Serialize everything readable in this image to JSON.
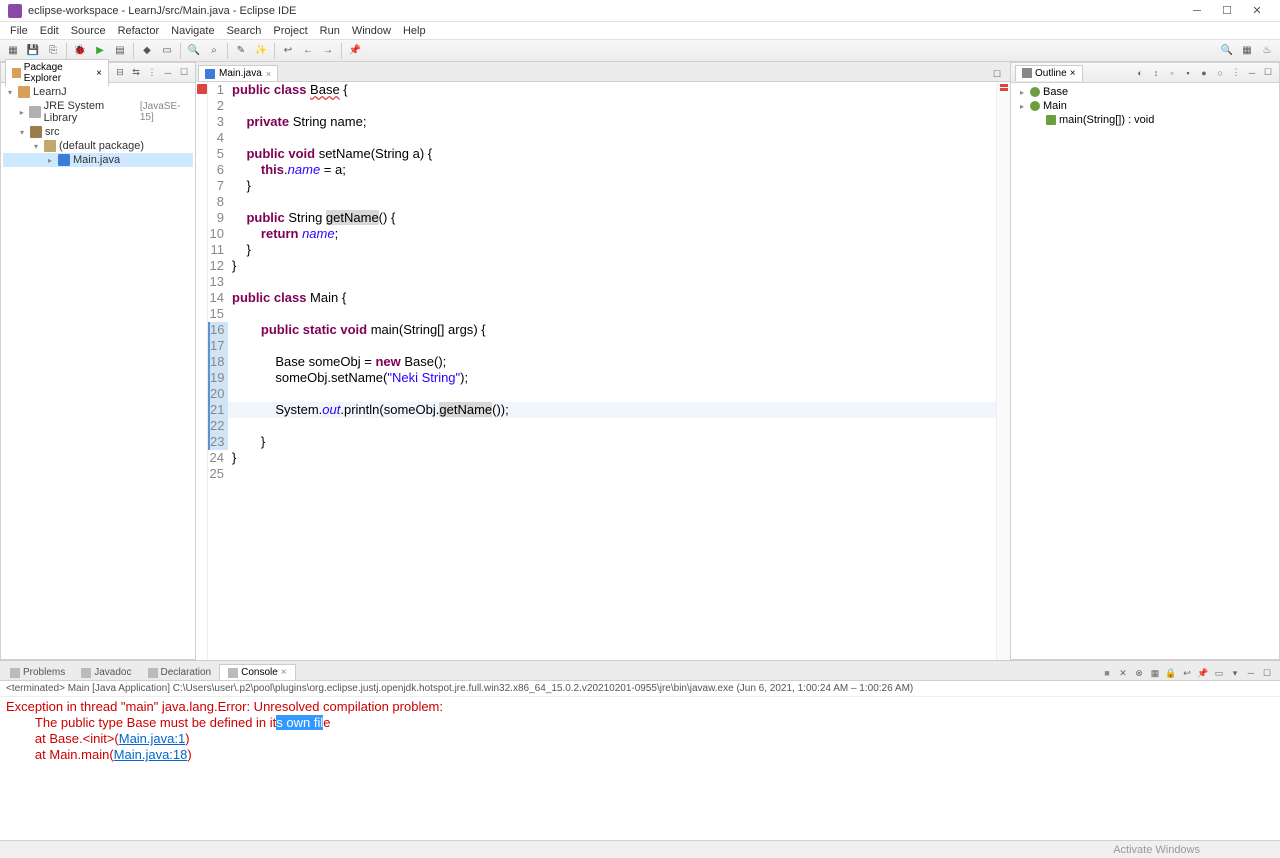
{
  "window": {
    "title": "eclipse-workspace - LearnJ/src/Main.java - Eclipse IDE"
  },
  "menu": [
    "File",
    "Edit",
    "Source",
    "Refactor",
    "Navigate",
    "Search",
    "Project",
    "Run",
    "Window",
    "Help"
  ],
  "explorer": {
    "title": "Package Explorer",
    "project": "LearnJ",
    "library": "JRE System Library",
    "library_deco": "[JavaSE-15]",
    "src": "src",
    "pkg": "(default package)",
    "file": "Main.java"
  },
  "editor": {
    "tab": "Main.java",
    "lines": [
      {
        "n": 1,
        "parts": [
          {
            "t": "public class ",
            "c": "kw"
          },
          {
            "t": "Base",
            "c": "type under"
          },
          {
            "t": " {",
            "c": ""
          }
        ]
      },
      {
        "n": 2,
        "parts": []
      },
      {
        "n": 3,
        "parts": [
          {
            "t": "    ",
            "c": ""
          },
          {
            "t": "private ",
            "c": "kw"
          },
          {
            "t": "String ",
            "c": ""
          },
          {
            "t": "name",
            "c": ""
          },
          {
            "t": ";",
            "c": ""
          }
        ]
      },
      {
        "n": 4,
        "parts": []
      },
      {
        "n": 5,
        "parts": [
          {
            "t": "    ",
            "c": ""
          },
          {
            "t": "public void ",
            "c": "kw"
          },
          {
            "t": "setName(String ",
            "c": ""
          },
          {
            "t": "a",
            "c": ""
          },
          {
            "t": ") {",
            "c": ""
          }
        ]
      },
      {
        "n": 6,
        "parts": [
          {
            "t": "        ",
            "c": ""
          },
          {
            "t": "this",
            "c": "kw"
          },
          {
            "t": ".",
            "c": ""
          },
          {
            "t": "name",
            "c": "fld"
          },
          {
            "t": " = ",
            "c": ""
          },
          {
            "t": "a",
            "c": ""
          },
          {
            "t": ";",
            "c": ""
          }
        ]
      },
      {
        "n": 7,
        "parts": [
          {
            "t": "    }",
            "c": ""
          }
        ]
      },
      {
        "n": 8,
        "parts": []
      },
      {
        "n": 9,
        "parts": [
          {
            "t": "    ",
            "c": ""
          },
          {
            "t": "public ",
            "c": "kw"
          },
          {
            "t": "String ",
            "c": ""
          },
          {
            "t": "getName",
            "c": "box"
          },
          {
            "t": "() {",
            "c": ""
          }
        ]
      },
      {
        "n": 10,
        "parts": [
          {
            "t": "        ",
            "c": ""
          },
          {
            "t": "return ",
            "c": "kw"
          },
          {
            "t": "name",
            "c": "fld"
          },
          {
            "t": ";",
            "c": ""
          }
        ]
      },
      {
        "n": 11,
        "parts": [
          {
            "t": "    }",
            "c": ""
          }
        ]
      },
      {
        "n": 12,
        "parts": [
          {
            "t": "}",
            "c": ""
          }
        ]
      },
      {
        "n": 13,
        "parts": []
      },
      {
        "n": 14,
        "parts": [
          {
            "t": "public class ",
            "c": "kw"
          },
          {
            "t": "Main {",
            "c": ""
          }
        ]
      },
      {
        "n": 15,
        "parts": []
      },
      {
        "n": 16,
        "parts": [
          {
            "t": "        ",
            "c": ""
          },
          {
            "t": "public static void ",
            "c": "kw"
          },
          {
            "t": "main(String[] ",
            "c": ""
          },
          {
            "t": "args",
            "c": ""
          },
          {
            "t": ") {",
            "c": ""
          }
        ]
      },
      {
        "n": 17,
        "parts": []
      },
      {
        "n": 18,
        "parts": [
          {
            "t": "            Base ",
            "c": ""
          },
          {
            "t": "someObj",
            "c": ""
          },
          {
            "t": " = ",
            "c": ""
          },
          {
            "t": "new ",
            "c": "kw"
          },
          {
            "t": "Base();",
            "c": ""
          }
        ]
      },
      {
        "n": 19,
        "parts": [
          {
            "t": "            ",
            "c": ""
          },
          {
            "t": "someObj",
            "c": ""
          },
          {
            "t": ".setName(",
            "c": ""
          },
          {
            "t": "\"Neki String\"",
            "c": "str"
          },
          {
            "t": ");",
            "c": ""
          }
        ]
      },
      {
        "n": 20,
        "parts": []
      },
      {
        "n": 21,
        "cur": true,
        "parts": [
          {
            "t": "            System.",
            "c": ""
          },
          {
            "t": "out",
            "c": "fld"
          },
          {
            "t": ".println(",
            "c": ""
          },
          {
            "t": "someObj",
            "c": ""
          },
          {
            "t": ".",
            "c": ""
          },
          {
            "t": "getName",
            "c": "box"
          },
          {
            "t": "());",
            "c": ""
          }
        ]
      },
      {
        "n": 22,
        "parts": []
      },
      {
        "n": 23,
        "parts": [
          {
            "t": "        }",
            "c": ""
          }
        ]
      },
      {
        "n": 24,
        "parts": [
          {
            "t": "}",
            "c": ""
          }
        ]
      },
      {
        "n": 25,
        "parts": []
      }
    ],
    "range_start": 16,
    "range_end": 23
  },
  "outline": {
    "title": "Outline",
    "items": [
      {
        "level": 0,
        "kind": "cls",
        "label": "Base"
      },
      {
        "level": 0,
        "kind": "cls",
        "label": "Main"
      },
      {
        "level": 1,
        "kind": "meth",
        "label": "main(String[]) : void"
      }
    ]
  },
  "bottom": {
    "tabs": [
      "Problems",
      "Javadoc",
      "Declaration",
      "Console"
    ],
    "active": 3,
    "info": "<terminated> Main [Java Application] C:\\Users\\user\\.p2\\pool\\plugins\\org.eclipse.justj.openjdk.hotspot.jre.full.win32.x86_64_15.0.2.v20210201-0955\\jre\\bin\\javaw.exe (Jun 6, 2021, 1:00:24 AM – 1:00:26 AM)",
    "console_lines": [
      {
        "pre": "Exception in thread \"main\" java.lang.Error: Unresolved compilation problem: ",
        "cls": "cerr"
      },
      {
        "pre": "\tThe public type Base must be defined in it",
        "sel": "s own fil",
        "post": "e",
        "cls": "cerr"
      },
      {
        "pre": "",
        "cls": ""
      },
      {
        "pre": "\tat Base.<init>(",
        "link": "Main.java:1",
        "post": ")",
        "cls": "cerr"
      },
      {
        "pre": "\tat Main.main(",
        "link": "Main.java:18",
        "post": ")",
        "cls": "cerr"
      }
    ]
  },
  "status": {
    "activate": "Activate Windows"
  }
}
